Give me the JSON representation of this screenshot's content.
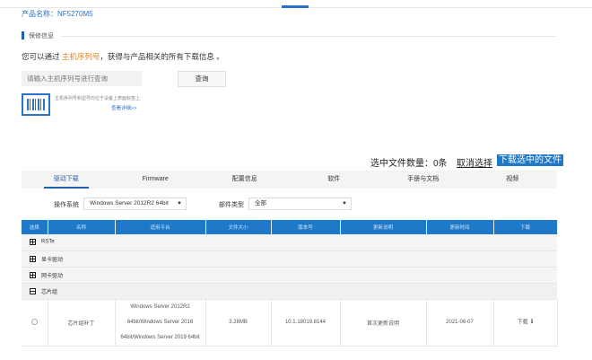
{
  "product": {
    "label": "产品名称：NF5270M5"
  },
  "warranty": {
    "title": "保修信息"
  },
  "intro": {
    "before": "您可以通过 ",
    "highlight": "主机序列号",
    "after": "，获得与产品相关的所有下载信息 。"
  },
  "search": {
    "placeholder": "请输入主机序列号进行查询",
    "button": "查询",
    "hint": "主机序列号和型号均位于设备上表面标签上",
    "detail_link": "查看详细>>"
  },
  "selection": {
    "count_label": "选中文件数量：",
    "count": "0条",
    "clear": "取消选择",
    "download_selected": "下载选中的文件"
  },
  "tabs": [
    {
      "label": "驱动下载",
      "active": true
    },
    {
      "label": "Firmware",
      "active": false
    },
    {
      "label": "配置信息",
      "active": false
    },
    {
      "label": "软件",
      "active": false
    },
    {
      "label": "手册与文档",
      "active": false
    },
    {
      "label": "视频",
      "active": false
    }
  ],
  "filters": {
    "os_label": "操作系统",
    "os_value": "Windows Server 2012R2 64bit",
    "type_label": "部件类型",
    "type_value": "全部"
  },
  "table": {
    "columns": [
      "选择",
      "名称",
      "适用平台",
      "文件大小",
      "版本号",
      "更新说明",
      "更新时间",
      "下载"
    ],
    "groups": [
      {
        "label": "RSTe",
        "expanded": false
      },
      {
        "label": "显卡驱动",
        "expanded": false
      },
      {
        "label": "网卡驱动",
        "expanded": false
      },
      {
        "label": "芯片组",
        "expanded": true
      }
    ],
    "file": {
      "name": "芯片组补丁",
      "platform_1": "Windows Server 2012R2",
      "platform_2": "64bit/Windows Server 2016",
      "platform_3": "64bit/Windows Server 2019 64bit",
      "size": "3.28MB",
      "version": "10.1.18019.8144",
      "notes": "首次更新说明",
      "date": "2021-06-07",
      "download": "下载"
    }
  },
  "icons": {
    "download": "download-icon",
    "barcode": "barcode-icon",
    "caret": "caret-down-icon"
  },
  "colors": {
    "accent": "#1f78c8",
    "highlight": "#e8841a",
    "link": "#2a6fc9"
  }
}
